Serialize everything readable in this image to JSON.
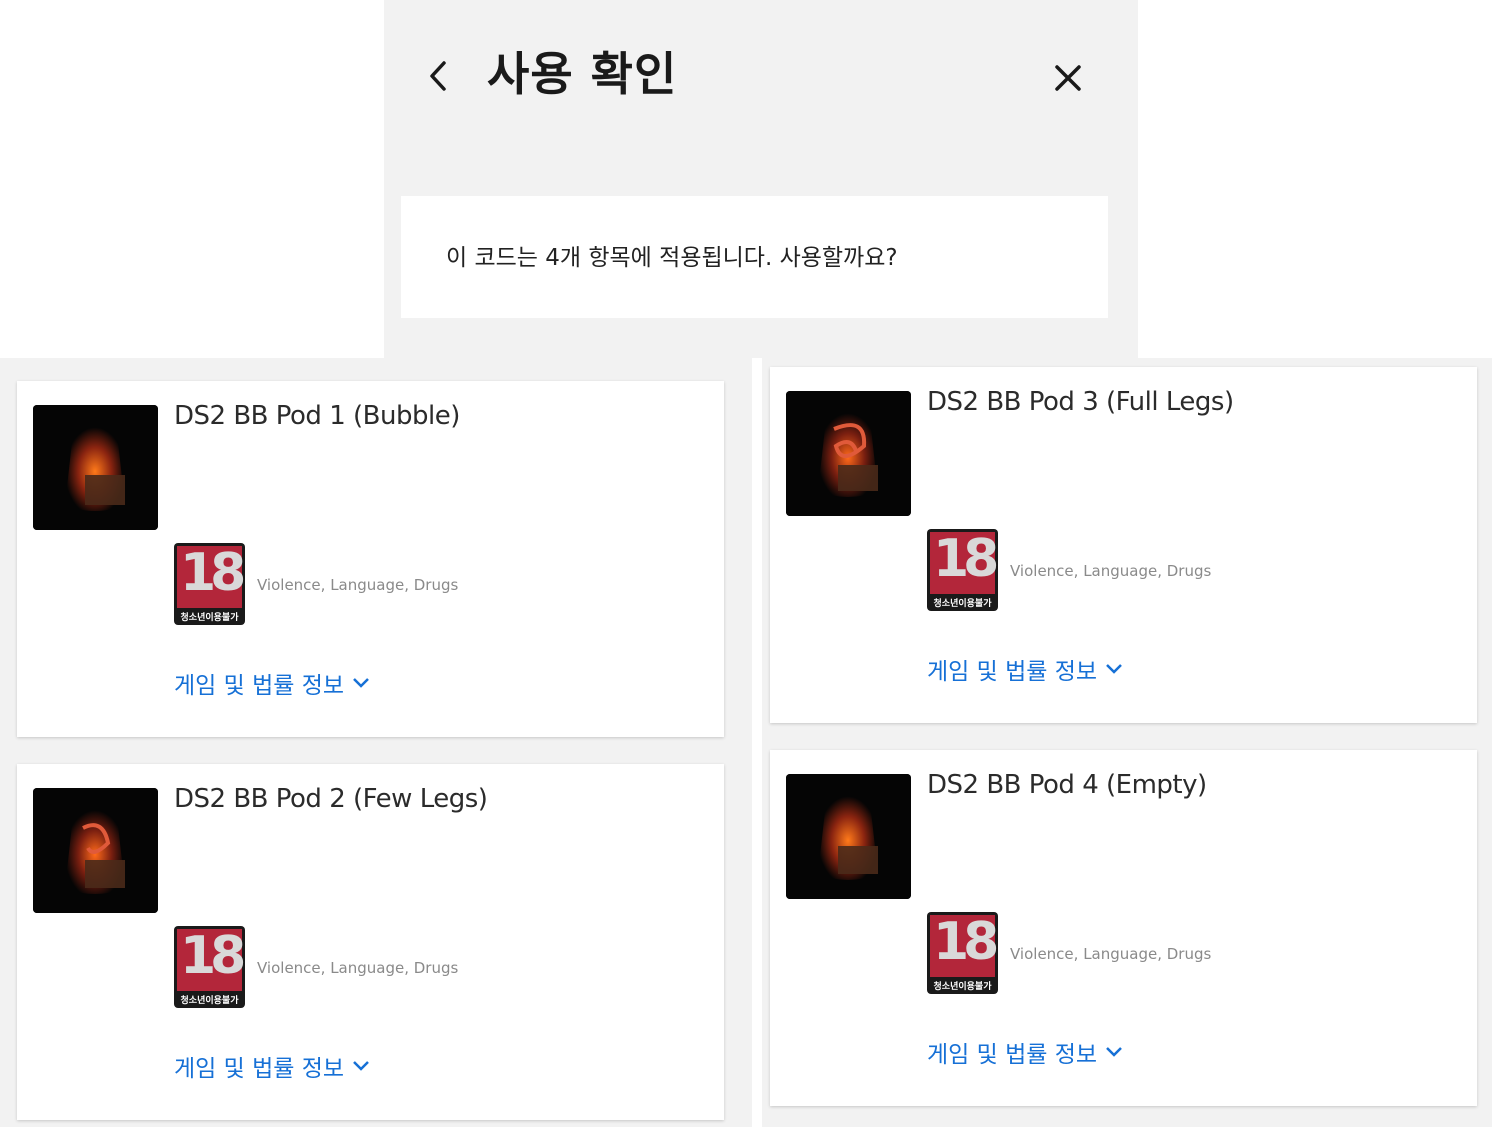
{
  "dialog": {
    "title": "사용 확인",
    "message": "이 코드는 4개 항목에 적용됩니다. 사용할까요?"
  },
  "items": [
    {
      "title": "DS2 BB Pod 1 (Bubble)",
      "rating_age": "18",
      "rating_label": "청소년이용불가",
      "rating_descriptors": "Violence, Language, Drugs",
      "info_link": "게임 및 법률 정보"
    },
    {
      "title": "DS2 BB Pod 2 (Few Legs)",
      "rating_age": "18",
      "rating_label": "청소년이용불가",
      "rating_descriptors": "Violence, Language, Drugs",
      "info_link": "게임 및 법률 정보"
    },
    {
      "title": "DS2 BB Pod 3 (Full Legs)",
      "rating_age": "18",
      "rating_label": "청소년이용불가",
      "rating_descriptors": "Violence, Language, Drugs",
      "info_link": "게임 및 법률 정보"
    },
    {
      "title": "DS2 BB Pod 4 (Empty)",
      "rating_age": "18",
      "rating_label": "청소년이용불가",
      "rating_descriptors": "Violence, Language, Drugs",
      "info_link": "게임 및 법률 정보"
    }
  ],
  "colors": {
    "link": "#1670d6",
    "rating_red": "#b3263a",
    "background": "#f2f2f2"
  },
  "icons": {
    "back": "chevron-left-icon",
    "close": "close-icon",
    "expand": "chevron-down-icon"
  }
}
